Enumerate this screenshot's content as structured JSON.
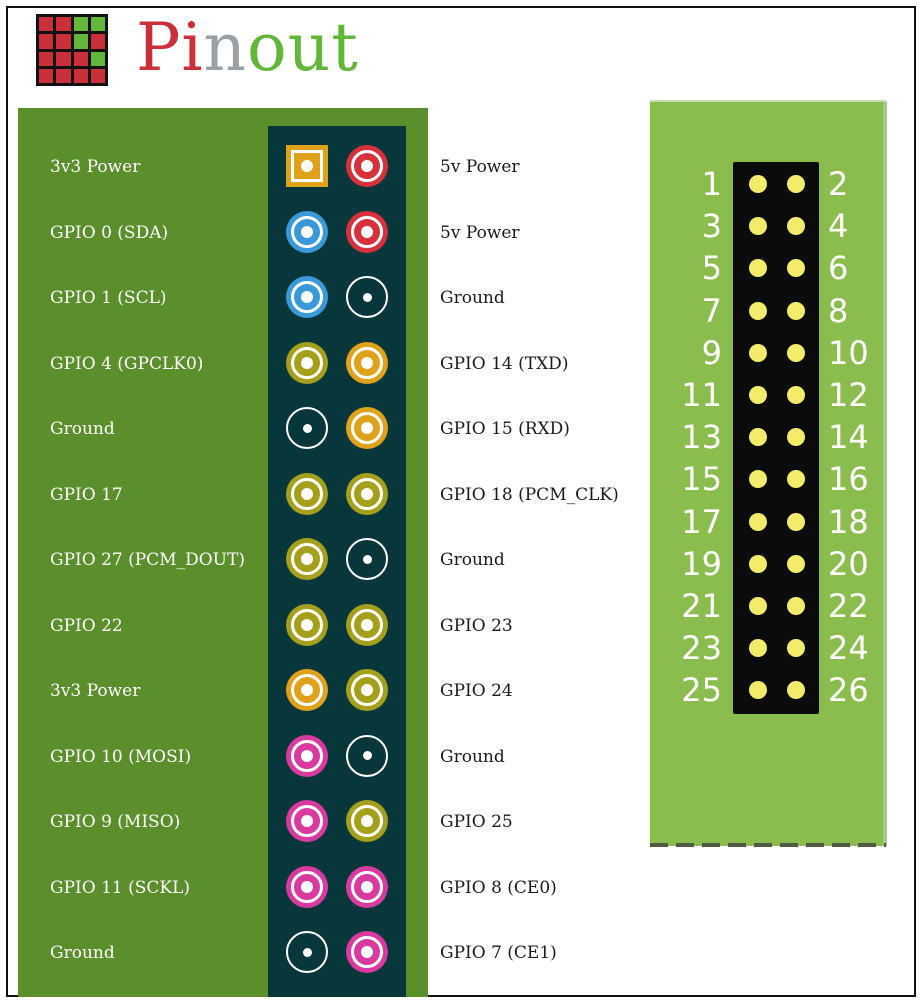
{
  "logo": {
    "text_parts": [
      {
        "t": "Pi",
        "color": "#c9303a"
      },
      {
        "t": "n",
        "color": "#9aa0a4"
      },
      {
        "t": "out",
        "color": "#62b63a"
      }
    ],
    "grid_colors": [
      "#c9303a",
      "#c9303a",
      "#62b63a",
      "#62b63a",
      "#c9303a",
      "#c9303a",
      "#62b63a",
      "#c9303a",
      "#c9303a",
      "#c9303a",
      "#c9303a",
      "#62b63a",
      "#c9303a",
      "#c9303a",
      "#c9303a",
      "#c9303a"
    ]
  },
  "colors": {
    "power3v3": "#e0a21a",
    "power5v": "#d7313b",
    "i2c": "#3a9ad9",
    "gpio": "#a5a01c",
    "uart": "#e0a21a",
    "spi": "#d83aa0",
    "ground": "#07363b"
  },
  "pinout": [
    {
      "left": "3v3 Power",
      "left_type": "power3v3",
      "right": "5v Power",
      "right_type": "power5v"
    },
    {
      "left": "GPIO 0 (SDA)",
      "left_type": "i2c",
      "right": "5v Power",
      "right_type": "power5v"
    },
    {
      "left": "GPIO 1 (SCL)",
      "left_type": "i2c",
      "right": "Ground",
      "right_type": "ground"
    },
    {
      "left": "GPIO 4 (GPCLK0)",
      "left_type": "gpio",
      "right": "GPIO 14 (TXD)",
      "right_type": "uart"
    },
    {
      "left": "Ground",
      "left_type": "ground",
      "right": "GPIO 15 (RXD)",
      "right_type": "uart"
    },
    {
      "left": "GPIO 17",
      "left_type": "gpio",
      "right": "GPIO 18 (PCM_CLK)",
      "right_type": "gpio"
    },
    {
      "left": "GPIO 27 (PCM_DOUT)",
      "left_type": "gpio",
      "right": "Ground",
      "right_type": "ground"
    },
    {
      "left": "GPIO 22",
      "left_type": "gpio",
      "right": "GPIO 23",
      "right_type": "gpio"
    },
    {
      "left": "3v3 Power",
      "left_type": "power3v3",
      "right": "GPIO 24",
      "right_type": "gpio"
    },
    {
      "left": "GPIO 10 (MOSI)",
      "left_type": "spi",
      "right": "Ground",
      "right_type": "ground"
    },
    {
      "left": "GPIO 9 (MISO)",
      "left_type": "spi",
      "right": "GPIO 25",
      "right_type": "gpio"
    },
    {
      "left": "GPIO 11 (SCKL)",
      "left_type": "spi",
      "right": "GPIO 8 (CE0)",
      "right_type": "spi"
    },
    {
      "left": "Ground",
      "left_type": "ground",
      "right": "GPIO 7 (CE1)",
      "right_type": "spi"
    }
  ],
  "header_pins": [
    {
      "odd": "1",
      "even": "2"
    },
    {
      "odd": "3",
      "even": "4"
    },
    {
      "odd": "5",
      "even": "6"
    },
    {
      "odd": "7",
      "even": "8"
    },
    {
      "odd": "9",
      "even": "10"
    },
    {
      "odd": "11",
      "even": "12"
    },
    {
      "odd": "13",
      "even": "14"
    },
    {
      "odd": "15",
      "even": "16"
    },
    {
      "odd": "17",
      "even": "18"
    },
    {
      "odd": "19",
      "even": "20"
    },
    {
      "odd": "21",
      "even": "22"
    },
    {
      "odd": "23",
      "even": "24"
    },
    {
      "odd": "25",
      "even": "26"
    }
  ]
}
